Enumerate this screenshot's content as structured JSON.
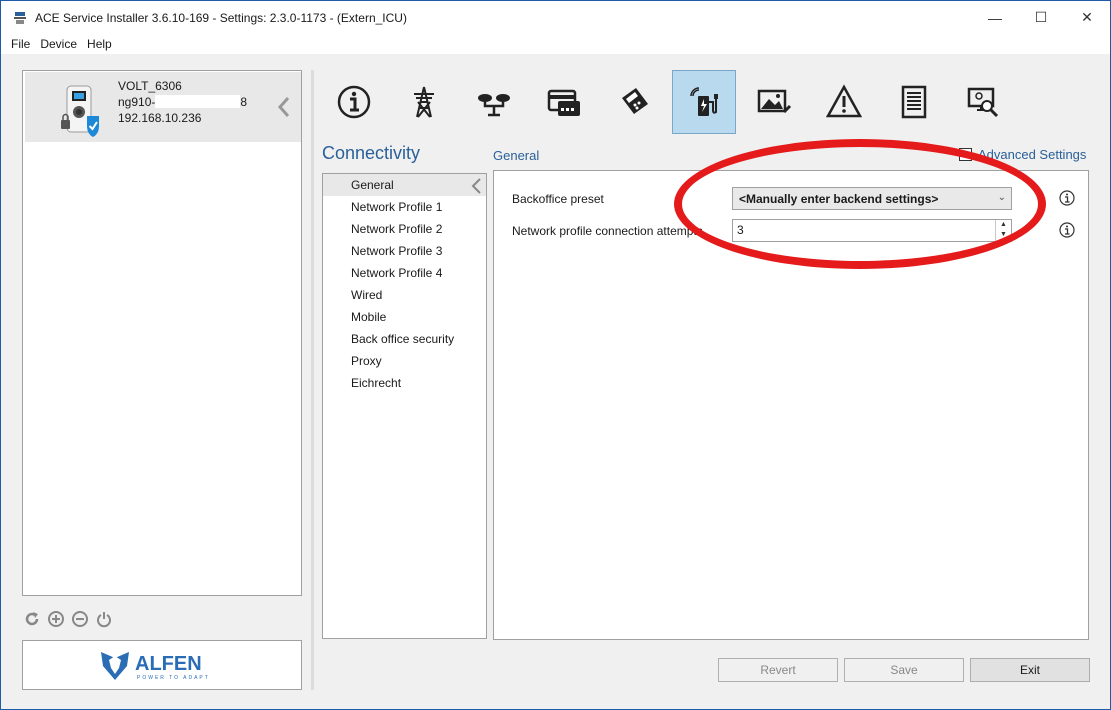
{
  "window": {
    "title": "ACE Service Installer 3.6.10-169 - Settings: 2.3.0-1173 -  (Extern_ICU)",
    "controls": [
      "—",
      "☐",
      "✕"
    ]
  },
  "menu": [
    "File",
    "Device",
    "Help"
  ],
  "device": {
    "name": "VOLT_6306",
    "serial_prefix": "ng910-",
    "serial_suffix": "8",
    "ip": "192.168.10.236"
  },
  "logo": {
    "text": "ALFEN",
    "tagline": "POWER TO ADAPT"
  },
  "toolbar": {
    "items": [
      {
        "icon": "info-icon"
      },
      {
        "icon": "power-tower-icon"
      },
      {
        "icon": "balance-icon"
      },
      {
        "icon": "card-reader-icon"
      },
      {
        "icon": "payment-terminal-icon"
      },
      {
        "icon": "connectivity-charger-icon",
        "active": true
      },
      {
        "icon": "display-image-icon"
      },
      {
        "icon": "warning-icon"
      },
      {
        "icon": "document-icon"
      },
      {
        "icon": "monitor-search-icon"
      }
    ]
  },
  "section": {
    "title": "Connectivity",
    "subtitle": "General",
    "advanced_label": "Advanced Settings"
  },
  "nav": {
    "items": [
      "General",
      "Network Profile 1",
      "Network Profile 2",
      "Network Profile 3",
      "Network Profile 4",
      "Wired",
      "Mobile",
      "Back office security",
      "Proxy",
      "Eichrecht"
    ],
    "selected": "General"
  },
  "form": {
    "backoffice_label": "Backoffice preset",
    "backoffice_value": "<Manually enter backend settings>",
    "attempts_label": "Network profile connection attempts",
    "attempts_value": "3"
  },
  "buttons": {
    "revert": "Revert",
    "save": "Save",
    "exit": "Exit"
  },
  "colors": {
    "accent": "#2a6099",
    "active_tab": "#b9d9ee",
    "highlight_ring": "#e51b1b"
  }
}
